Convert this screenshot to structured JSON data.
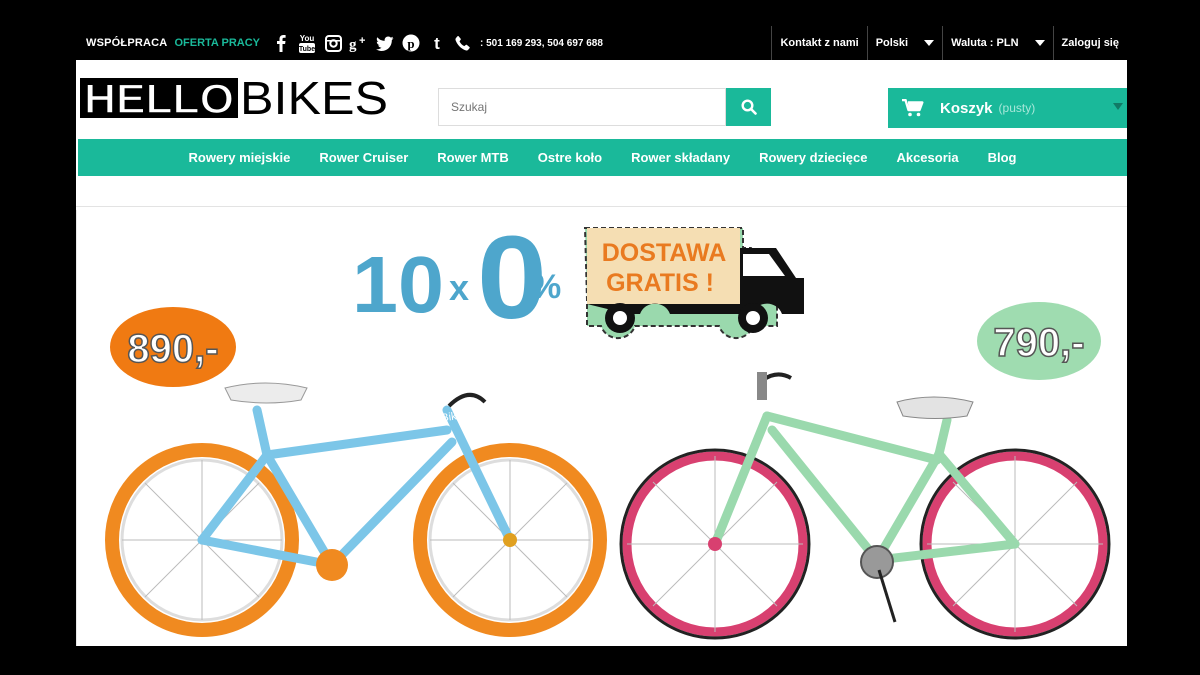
{
  "topbar": {
    "wspolpraca": "WSPÓŁPRACA",
    "oferta": "OFERTA PRACY",
    "social_icons": [
      "facebook-icon",
      "youtube-icon",
      "instagram-icon",
      "google-plus-icon",
      "twitter-icon",
      "pinterest-icon",
      "tumblr-icon"
    ],
    "youtube_text": "You",
    "phone": ": 501 169 293, 504 697 688",
    "contact": "Kontakt z nami",
    "language": "Polski",
    "currency": "Waluta : PLN",
    "login": "Zaloguj się"
  },
  "header": {
    "logo_left": "HELLO",
    "logo_right": "BIKES",
    "search_placeholder": "Szukaj",
    "cart_label": "Koszyk",
    "cart_state": "(pusty)"
  },
  "nav": {
    "items": [
      "Rowery miejskie",
      "Rower Cruiser",
      "Rower MTB",
      "Ostre koło",
      "Rower składany",
      "Rowery dziecięce",
      "Akcesoria",
      "Blog"
    ]
  },
  "banner": {
    "promo_prefix": "10",
    "promo_x": "x",
    "promo_zero": "0",
    "promo_pct": "%",
    "delivery_line1": "DOSTAWA",
    "delivery_line2": "GRATIS !",
    "price_left": "890,-",
    "price_right": "790,-",
    "frame_text": "HelloBikes"
  },
  "colors": {
    "accent": "#1ab99a",
    "promo_blue": "#4ea6cc",
    "price_orange": "#f07a12",
    "price_green": "#9fdcb0",
    "bike_blue": "#7cc6e8",
    "bike_mint": "#9ad9ad",
    "rim_orange": "#f08a20",
    "rim_pink": "#d84070"
  }
}
